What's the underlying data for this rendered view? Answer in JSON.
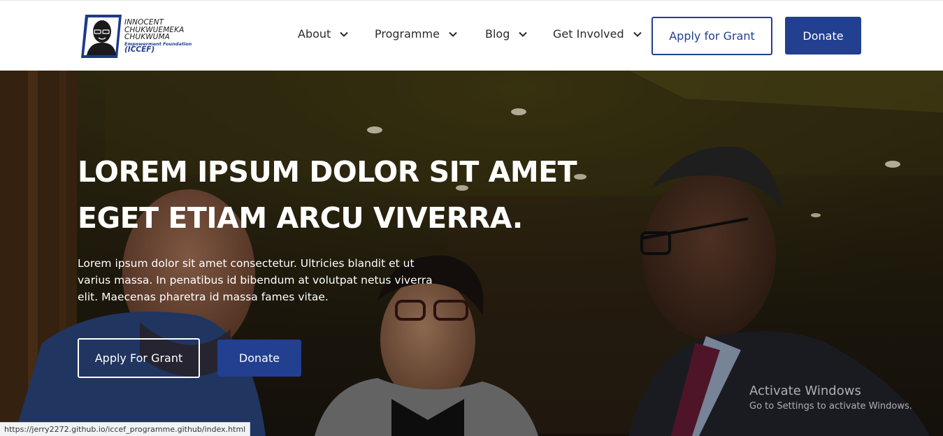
{
  "logo": {
    "line1": "INNOCENT",
    "line2": "CHUKWUEMEKA",
    "line3": "CHUKWUMA",
    "sub": "Empowerment Foundation",
    "acronym": "(ICCEF)"
  },
  "nav": {
    "items": [
      {
        "label": "About",
        "icon": "chevron-down-icon"
      },
      {
        "label": "Programme",
        "icon": "chevron-down-icon"
      },
      {
        "label": "Blog",
        "icon": "chevron-down-icon"
      },
      {
        "label": "Get Involved",
        "icon": "chevron-down-icon"
      }
    ],
    "apply_label": "Apply for Grant",
    "donate_label": "Donate"
  },
  "hero": {
    "title_line1": "LOREM IPSUM DOLOR SIT AMET",
    "title_line2": "EGET ETIAM ARCU VIVERRA.",
    "text": "Lorem ipsum dolor sit amet consectetur. Ultricies blandit et ut varius massa. In penatibus id bibendum at volutpat netus viverra elit. Maecenas pharetra id massa fames vitae.",
    "apply_label": "Apply For Grant",
    "donate_label": "Donate"
  },
  "os_overlay": {
    "activate_title": "Activate Windows",
    "activate_sub": "Go to Settings to activate Windows."
  },
  "status_bar": {
    "url": "https://jerry2272.github.io/iccef_programme.github/index.html"
  },
  "colors": {
    "brand_blue": "#223f90",
    "header_bg": "#ffffff",
    "hero_text": "#ffffff"
  }
}
